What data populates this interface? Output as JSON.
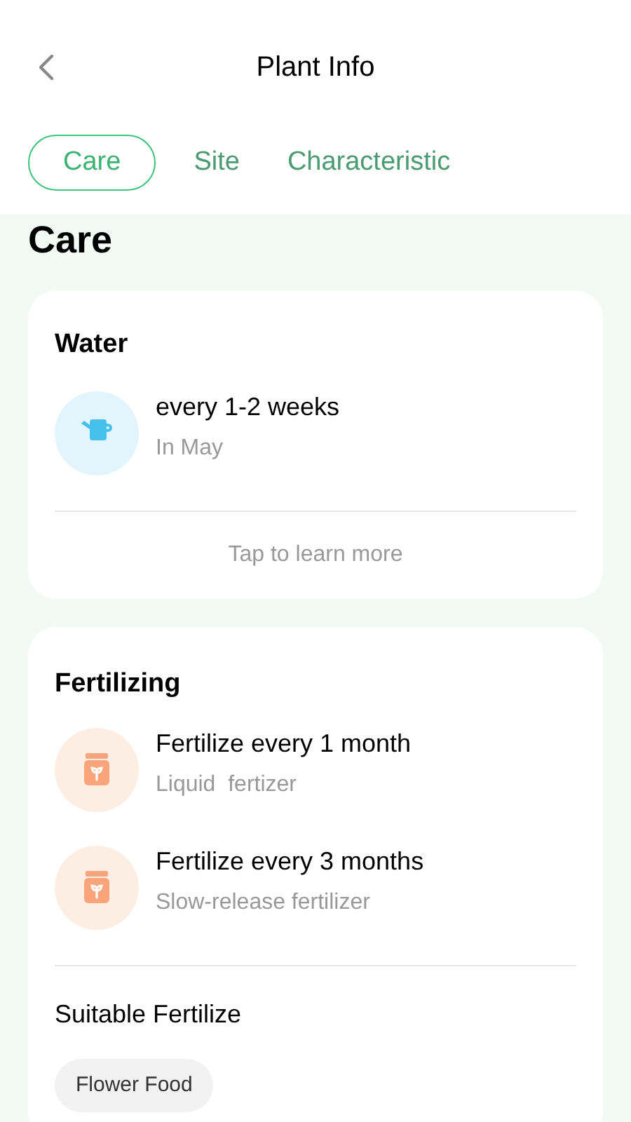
{
  "header": {
    "title": "Plant Info"
  },
  "tabs": [
    {
      "label": "Care",
      "selected": true
    },
    {
      "label": "Site",
      "selected": false
    },
    {
      "label": "Characteristic",
      "selected": false
    }
  ],
  "section_title": "Care",
  "water": {
    "title": "Water",
    "items": [
      {
        "kind": "water",
        "title": "every 1-2 weeks",
        "subtitle": "In May"
      }
    ],
    "link": "Tap to learn more"
  },
  "fertilizing": {
    "title": "Fertilizing",
    "items": [
      {
        "kind": "fertilizer",
        "title": "Fertilize every 1 month",
        "subtitle": "Liquid  fertizer"
      },
      {
        "kind": "fertilizer",
        "title": "Fertilize every 3 months",
        "subtitle": "Slow-release fertilizer"
      }
    ],
    "suitable_title": "Suitable Fertilize",
    "tags": [
      "Flower Food"
    ]
  }
}
